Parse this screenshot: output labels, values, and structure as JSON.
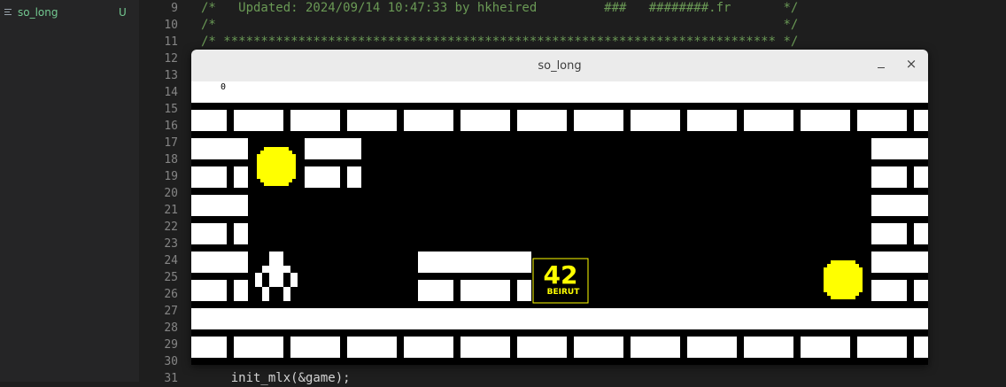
{
  "sidebar": {
    "file": {
      "name": "so_long",
      "status": "U",
      "icon": "file-lines-icon"
    }
  },
  "editor": {
    "lines": [
      {
        "n": "9",
        "text": "/*   Updated: 2024/09/14 10:47:33 by hkheired         ###   ########.fr       */"
      },
      {
        "n": "10",
        "text": "/*                                                                            */"
      },
      {
        "n": "11",
        "text": "/* ************************************************************************** */"
      },
      {
        "n": "12",
        "text": ""
      },
      {
        "n": "13",
        "text": ""
      },
      {
        "n": "14",
        "text": ""
      },
      {
        "n": "15",
        "text": ""
      },
      {
        "n": "16",
        "text": ""
      },
      {
        "n": "17",
        "text": ""
      },
      {
        "n": "18",
        "text": ""
      },
      {
        "n": "19",
        "text": ""
      },
      {
        "n": "20",
        "text": ""
      },
      {
        "n": "21",
        "text": ""
      },
      {
        "n": "22",
        "text": ""
      },
      {
        "n": "23",
        "text": ""
      },
      {
        "n": "24",
        "text": ""
      },
      {
        "n": "25",
        "text": ""
      },
      {
        "n": "26",
        "text": ""
      },
      {
        "n": "27",
        "text": ""
      },
      {
        "n": "28",
        "text": ""
      },
      {
        "n": "29",
        "text": ""
      },
      {
        "n": "30",
        "text": ""
      },
      {
        "n": "31",
        "text": "    init_mlx(&game);"
      }
    ],
    "colors": {
      "comment": "#6a9955",
      "code": "#d4d4d4"
    }
  },
  "window": {
    "title": "so_long",
    "minimize_icon": "minimize-icon",
    "close_icon": "close-icon",
    "close_glyph": "×"
  },
  "game": {
    "moves": "0",
    "exit_label": "42",
    "exit_sub": "BEIRUT",
    "colors": {
      "wall": "#ffffff",
      "floor": "#000000",
      "collectible": "#ffff00"
    },
    "map": [
      "1111111111111",
      "1C1000000000001",
      "1000000000001",
      "1P00110E000C1",
      "1111111111111"
    ]
  }
}
